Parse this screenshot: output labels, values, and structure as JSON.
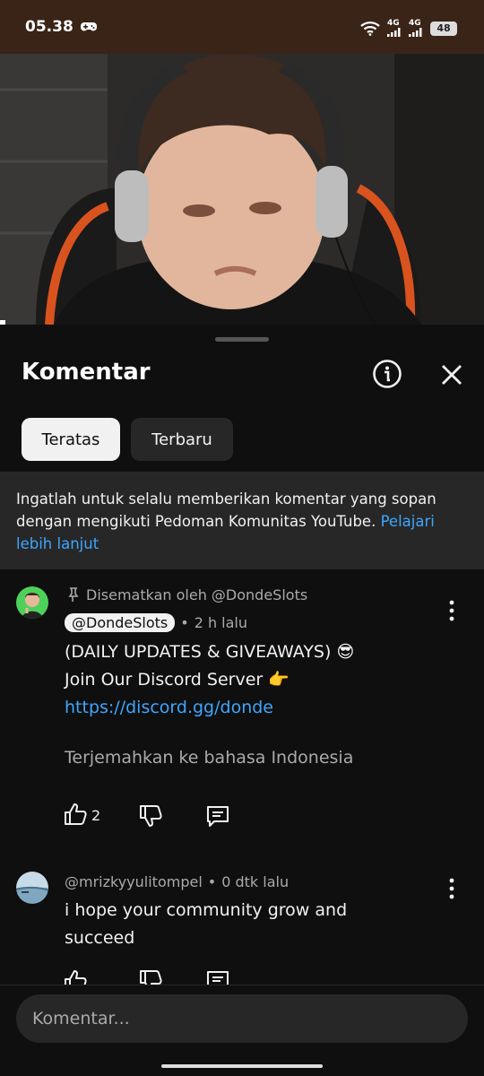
{
  "status_bar": {
    "time": "05.38",
    "network_1": "4G",
    "network_2": "4G",
    "battery": "48"
  },
  "comments_sheet": {
    "title": "Komentar",
    "filters": [
      "Teratas",
      "Terbaru"
    ],
    "notice": {
      "text": "Ingatlah untuk selalu memberikan komentar yang sopan dengan mengikuti Pedoman Komunitas YouTube.",
      "link": "Pelajari lebih lanjut"
    },
    "comments": [
      {
        "pinned_label": "Disematkan oleh @DondeSlots",
        "author": "@DondeSlots",
        "time": "2 h lalu",
        "line1": "(DAILY UPDATES & GIVEAWAYS) 😎",
        "line2": "Join Our Discord Server 👉",
        "link": "https://discord.gg/donde",
        "translate": "Terjemahkan ke bahasa Indonesia",
        "likes": "2"
      },
      {
        "author": "@mrizkyyulitompel",
        "time": "0 dtk lalu",
        "line1": "i hope your community grow and",
        "line2": "succeed"
      }
    ],
    "input_placeholder": "Komentar..."
  },
  "colors": {
    "background": "#0f0f0f",
    "chip_active": "#f1f1f1",
    "chip_inactive": "#272727",
    "link": "#3ea6ff",
    "secondary_text": "#aaaaaa"
  }
}
